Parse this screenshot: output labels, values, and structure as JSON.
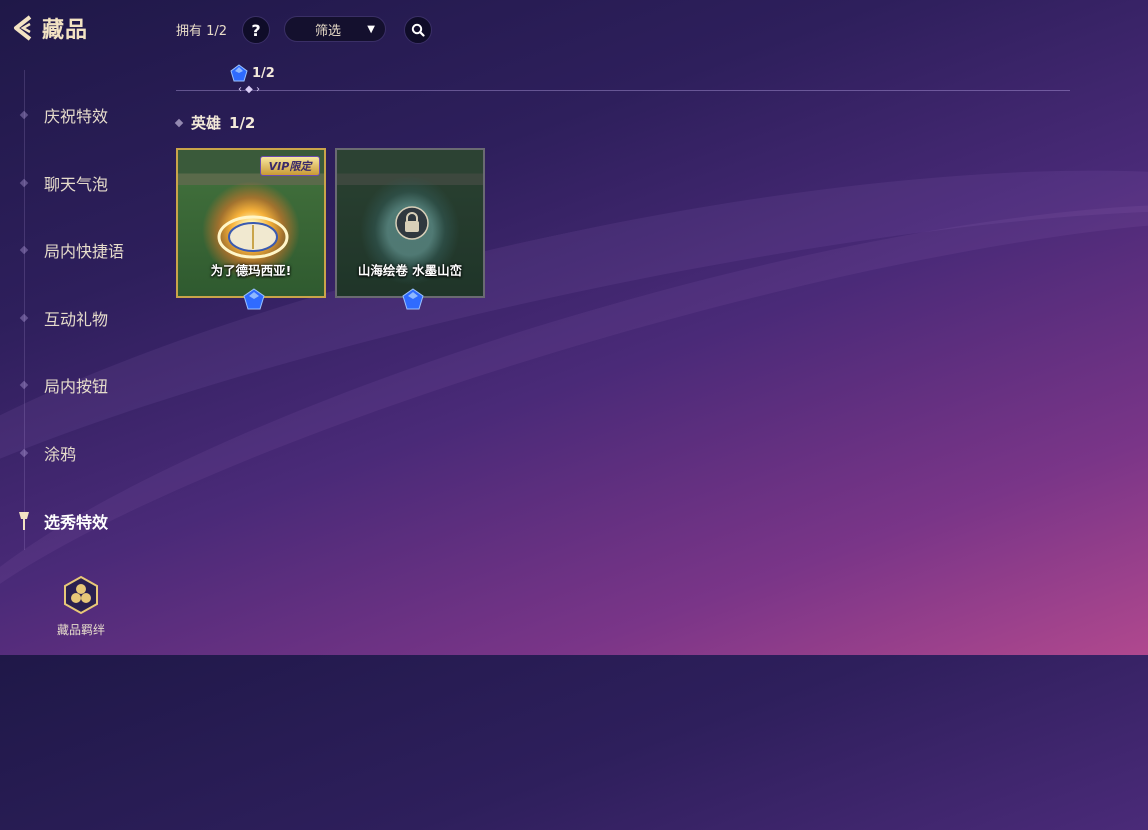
{
  "header": {
    "title": "藏品",
    "owned": "拥有 1/2",
    "help": "?",
    "filter_label": "筛选"
  },
  "progress": {
    "count": "1/2"
  },
  "sidebar": {
    "items": [
      {
        "label": "庆祝特效"
      },
      {
        "label": "聊天气泡"
      },
      {
        "label": "局内快捷语"
      },
      {
        "label": "互动礼物"
      },
      {
        "label": "局内按钮"
      },
      {
        "label": "涂鸦"
      },
      {
        "label": "选秀特效"
      }
    ],
    "active_index": 6,
    "bond_label": "藏品羁绊"
  },
  "section": {
    "title": "英雄",
    "count": "1/2"
  },
  "cards": [
    {
      "label": "为了德玛西亚!",
      "badge": "VIP限定",
      "locked": false
    },
    {
      "label": "山海绘卷 水墨山峦",
      "locked": true
    }
  ],
  "colors": {
    "gold": "#c9a44a",
    "gem": "#2f6bff",
    "title": "#f3e3c3"
  },
  "icons": [
    "back-arrow-icon",
    "help-icon",
    "chevron-down-icon",
    "search-icon",
    "gem-icon",
    "pin-icon",
    "hexagon-bond-icon",
    "lock-icon"
  ]
}
